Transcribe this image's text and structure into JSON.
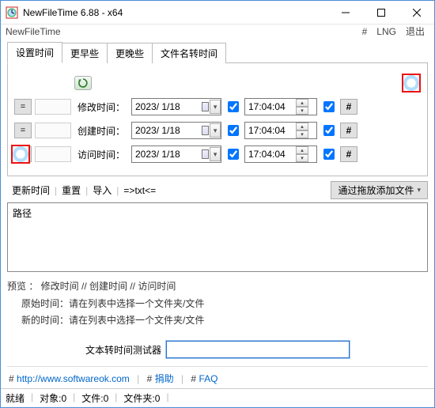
{
  "titlebar": {
    "title": "NewFileTime 6.88 - x64"
  },
  "menubar": {
    "appname": "NewFileTime",
    "hash": "#",
    "lang": "LNG",
    "exit": "退出"
  },
  "tabs": [
    "设置时间",
    "更早些",
    "更晚些",
    "文件名转时间"
  ],
  "rows": {
    "eq": "=",
    "hash": "#",
    "modify": {
      "label": "修改时间：",
      "date": "2023/ 1/18",
      "time": "17:04:04"
    },
    "create": {
      "label": "创建时间：",
      "date": "2023/ 1/18",
      "time": "17:04:04"
    },
    "access": {
      "label": "访问时间：",
      "date": "2023/ 1/18",
      "time": "17:04:04"
    }
  },
  "toolbar2": {
    "update": "更新时间",
    "reset": "重置",
    "import": "导入",
    "txt": "=>txt<=",
    "dropadd": "通过拖放添加文件"
  },
  "list": {
    "col_path": "路径"
  },
  "preview": {
    "line1": "预览  ：  修改时间    //    创建时间    //    访问时间",
    "orig": "原始时间：请在列表中选择一个文件夹/文件",
    "newt": "新的时间：请在列表中选择一个文件夹/文件"
  },
  "tester": {
    "label": "文本转时间测试器",
    "value": ""
  },
  "btmlinks": {
    "hash": "#",
    "url": "http://www.softwareok.com",
    "donate": "捐助",
    "faq": "FAQ"
  },
  "status": {
    "ready": "就绪",
    "objects": "对象:0",
    "files": "文件:0",
    "folders": "文件夹:0"
  }
}
